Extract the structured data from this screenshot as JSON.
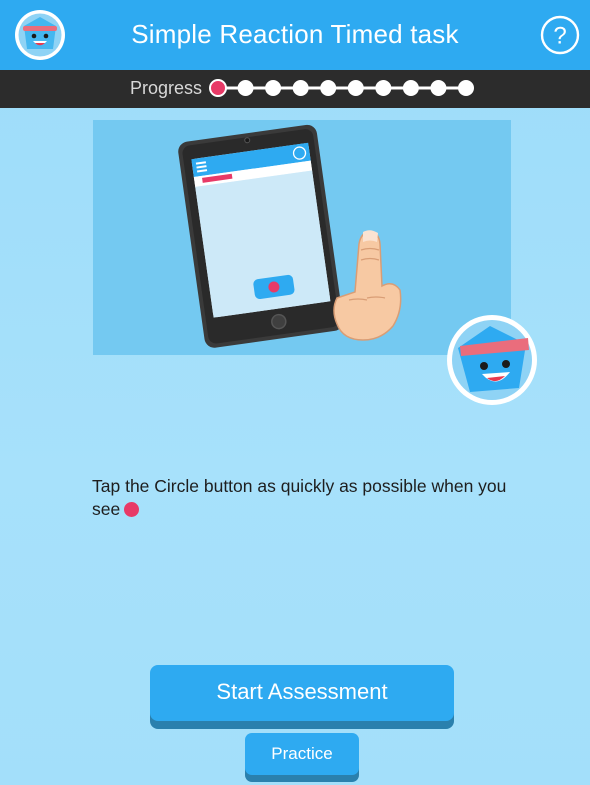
{
  "header": {
    "title": "Simple Reaction Timed task",
    "help_glyph": "?",
    "avatar_icon": "mascot-face-icon",
    "help_icon": "help-circle-icon"
  },
  "progress": {
    "label": "Progress",
    "total_steps": 10,
    "current_step": 1,
    "active_color": "#e83a67",
    "inactive_color": "#ffffff"
  },
  "illustration": {
    "phone_icon": "phone-tap-illustration",
    "hand_icon": "pointing-hand-icon"
  },
  "instruction": {
    "text": "Tap the Circle button as quickly as possible when you see"
  },
  "buttons": {
    "start_label": "Start Assessment",
    "practice_label": "Practice"
  },
  "colors": {
    "header_bg": "#2eaaf1",
    "background": "#a4dffa",
    "button_bg": "#2eaaf1",
    "button_shadow": "#2a80ad",
    "accent_dot": "#e83a67"
  }
}
